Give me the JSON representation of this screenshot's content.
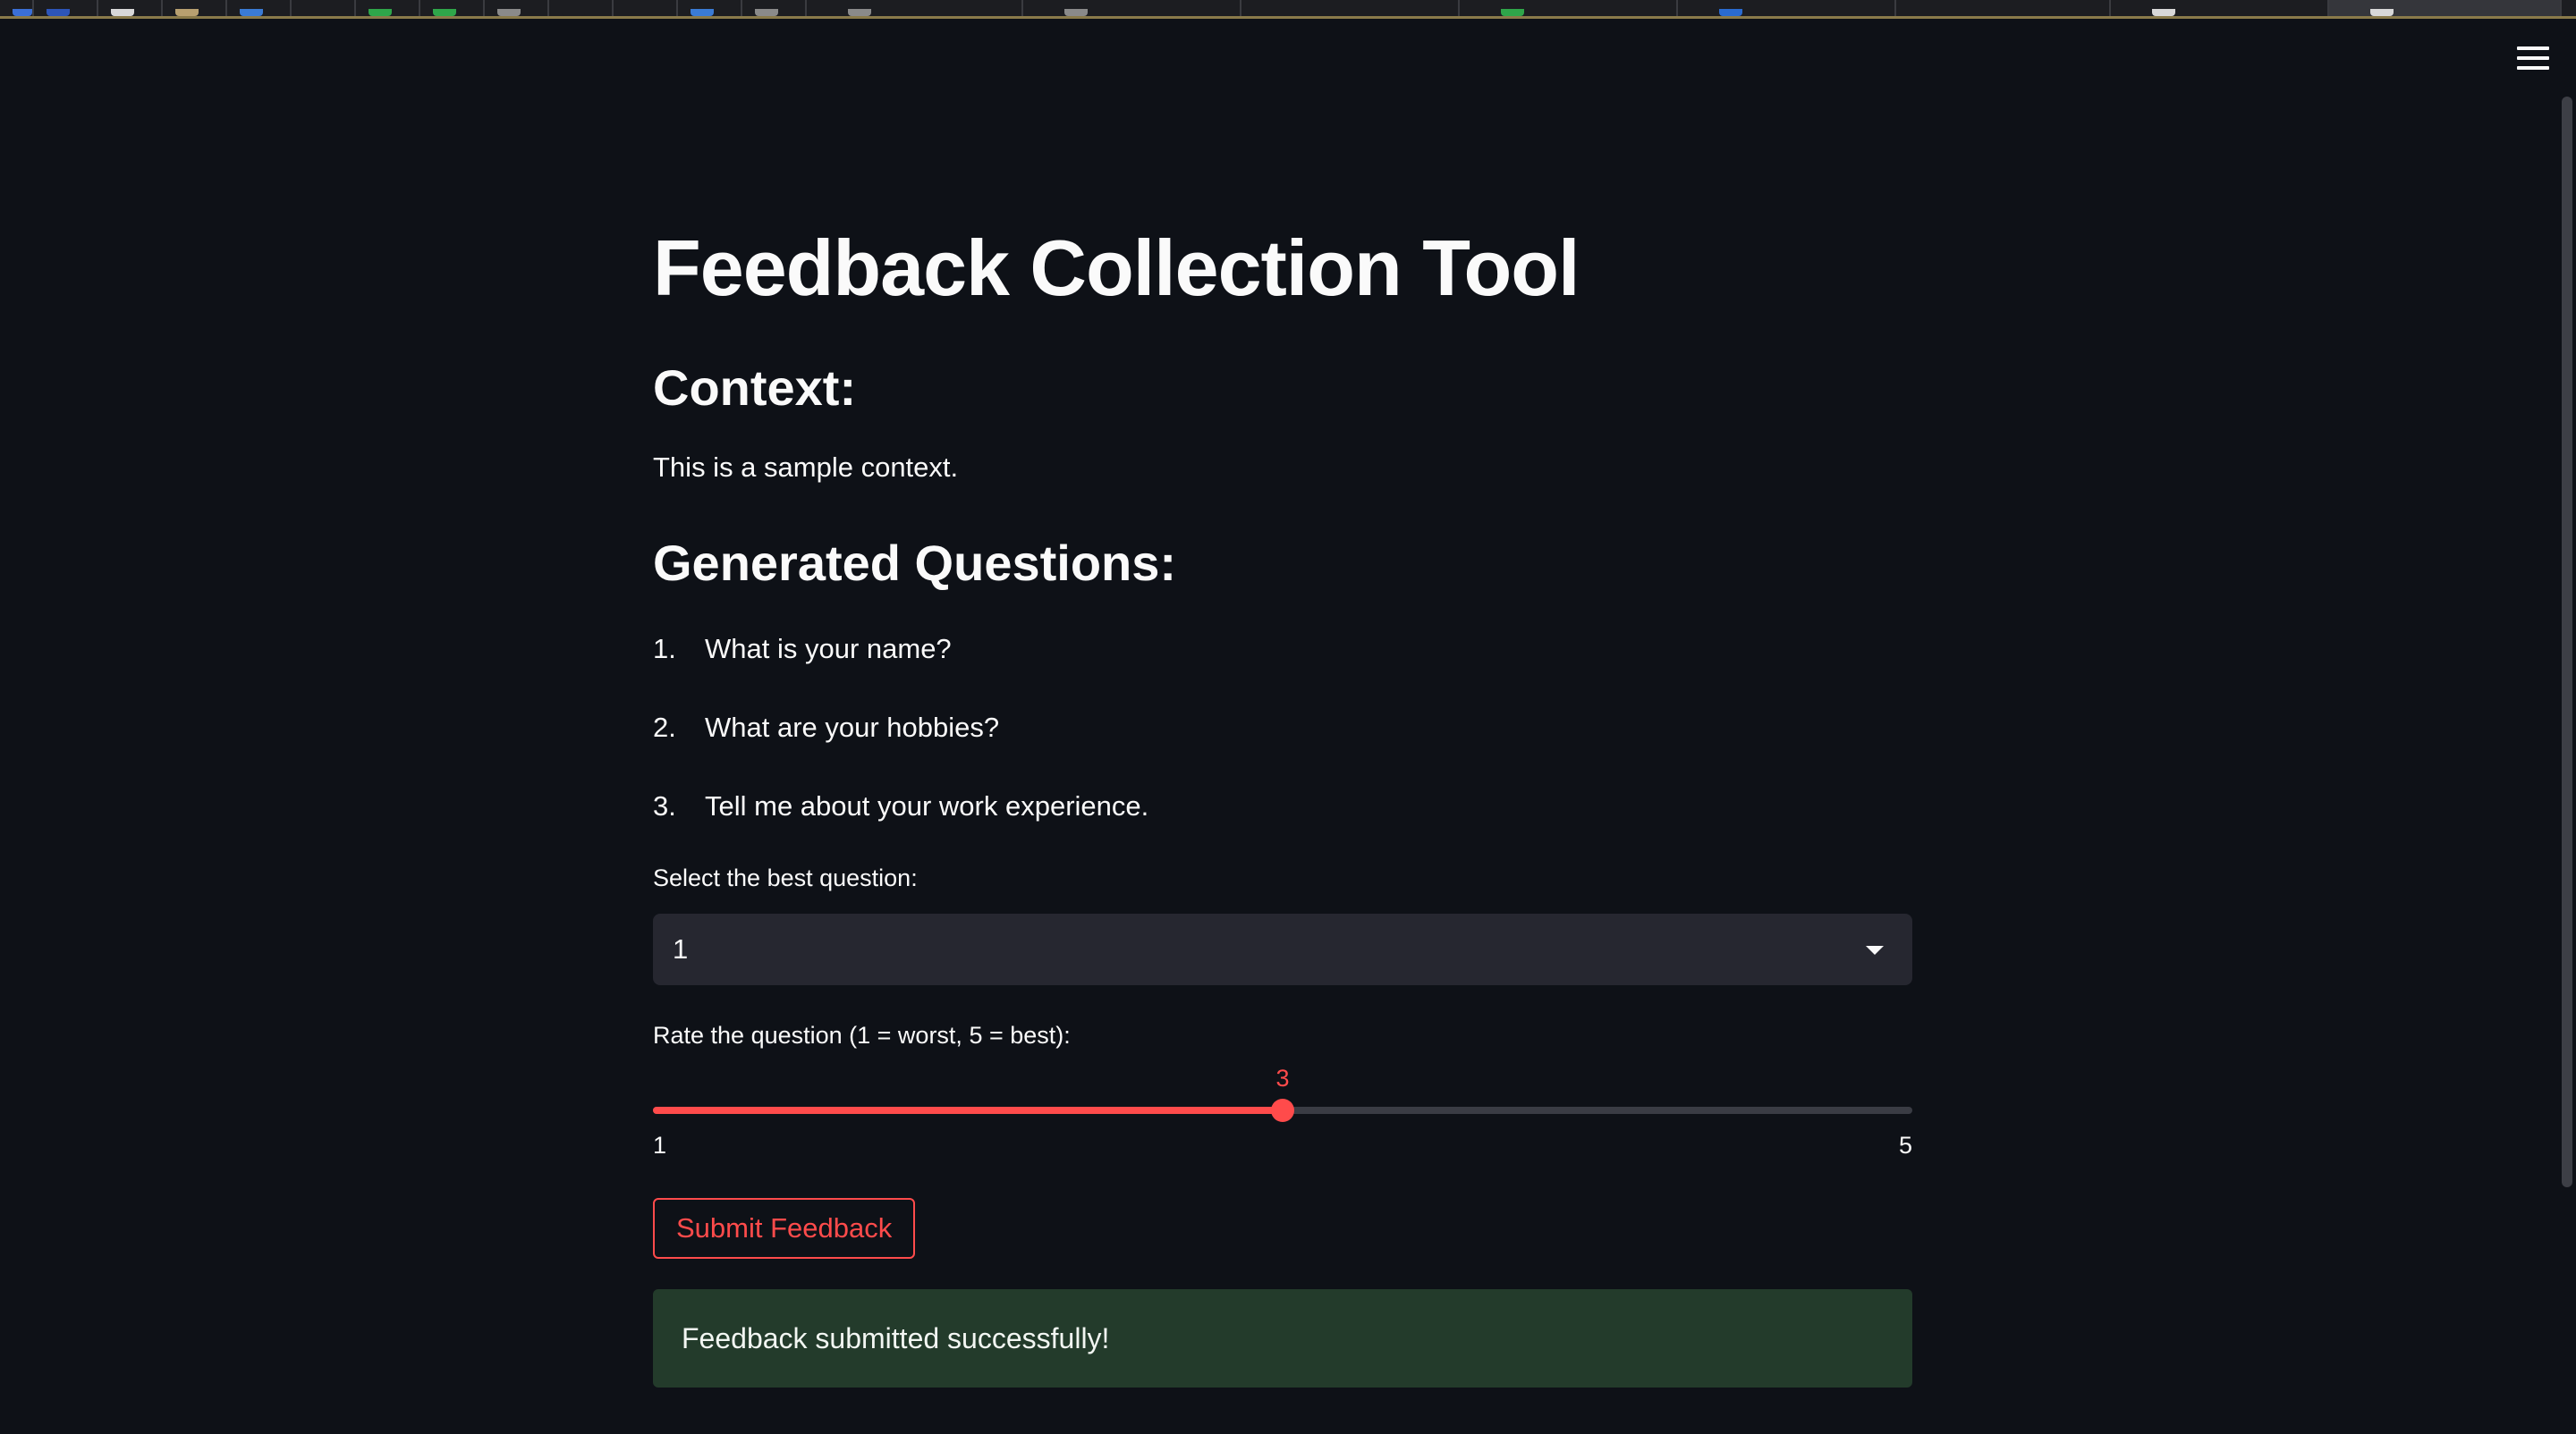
{
  "page": {
    "title": "Feedback Collection Tool",
    "context_heading": "Context:",
    "context_text": "This is a sample context.",
    "questions_heading": "Generated Questions:"
  },
  "questions": [
    {
      "num": "1.",
      "text": "What is your name?"
    },
    {
      "num": "2.",
      "text": "What are your hobbies?"
    },
    {
      "num": "3.",
      "text": "Tell me about your work experience."
    }
  ],
  "select": {
    "label": "Select the best question:",
    "value": "1"
  },
  "slider": {
    "label": "Rate the question (1 = worst, 5 = best):",
    "value": 3,
    "value_text": "3",
    "min": 1,
    "max": 5,
    "min_label": "1",
    "max_label": "5"
  },
  "submit_button": {
    "label": "Submit Feedback"
  },
  "alert": {
    "message": "Feedback submitted successfully!"
  },
  "colors": {
    "background": "#0e1117",
    "accent": "#ff4b4b",
    "success_bg": "#233b2b",
    "input_bg": "#262730"
  },
  "icons": {
    "menu": "hamburger-menu-icon",
    "dropdown": "chevron-down-icon"
  }
}
